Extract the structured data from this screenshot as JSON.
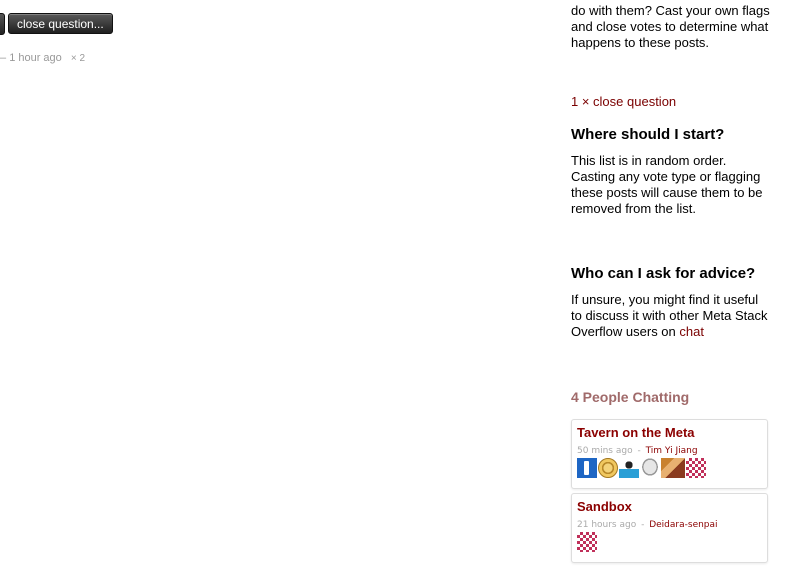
{
  "question": {
    "close_button_label": "close question...",
    "meta_dash": "–",
    "meta_time": "1 hour ago",
    "meta_count": "× 2"
  },
  "sidebar": {
    "intro_text": "do with them? Cast your own flags and close votes to determine what happens to these posts.",
    "tag_link": "1 × close question",
    "start_heading": "Where should I start?",
    "start_text": "This list is in random order. Casting any vote type or flagging these posts will cause them to be removed from the list.",
    "advice_heading": "Who can I ask for advice?",
    "advice_text": "If unsure, you might find it useful to discuss it with other Meta Stack Overflow users on",
    "advice_link": "chat",
    "people_heading": "4 People Chatting"
  },
  "rooms": [
    {
      "name": "Tavern on the Meta",
      "time": "50 mins ago",
      "sep": "-",
      "user": "Tim Yi Jiang",
      "avatars": [
        "blue-stack-avatar",
        "coin-avatar",
        "robot-avatar",
        "skull-avatar",
        "photo-avatar",
        "pixel-avatar"
      ]
    },
    {
      "name": "Sandbox",
      "time": "21 hours ago",
      "sep": "-",
      "user": "Deidara-senpai",
      "avatars": [
        "pixel-avatar"
      ]
    }
  ],
  "colors": {
    "link": "#7a0000",
    "room_name": "#8b0000",
    "people_heading": "#a06a6a",
    "meta_gray": "#999999"
  }
}
